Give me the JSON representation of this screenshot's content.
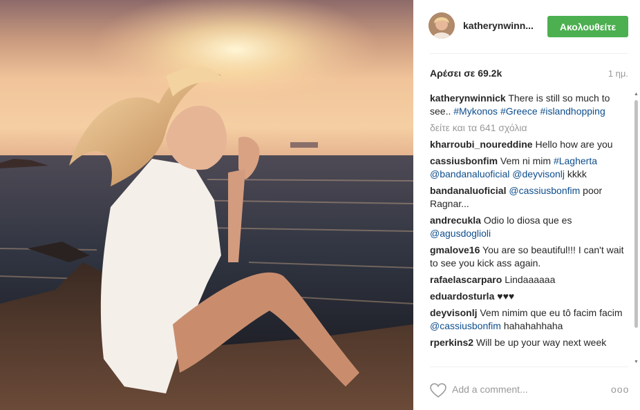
{
  "post": {
    "photo_icon": "photo",
    "username": "katherynwinn...",
    "follow_label": "Ακολουθείτε",
    "likes_text": "Αρέσει σε 69.2k",
    "time_text": "1 ημ.",
    "view_all_text": "δείτε και τα 641 σχόλια",
    "add_comment_placeholder": "Add a comment...",
    "more_label": "ooo",
    "colors": {
      "follow_button": "#4caf50",
      "hashtag": "#0d4d8c",
      "muted": "#999999"
    }
  },
  "caption": {
    "user": "katherynwinnick",
    "text": "There is still so much to see..",
    "tags": [
      "#Mykonos",
      "#Greece",
      "#islandhopping"
    ]
  },
  "comments": [
    {
      "user": "kharroubi_noureddine",
      "text": "Hello how are you"
    },
    {
      "user": "cassiusbonfim",
      "text": "Vem ni mim",
      "tags": [
        "#Lagherta",
        "@bandanaluoficial",
        "@deyvisonlj"
      ],
      "text2": "kkkk"
    },
    {
      "user": "bandanaluoficial",
      "tag": "@cassiusbonfim",
      "text": "poor Ragnar..."
    },
    {
      "user": "andrecukla",
      "text": "Odio lo diosa que es",
      "tag": "@agusdoglioli"
    },
    {
      "user": "gmalove16",
      "text": "You are so beautiful!!! I can't wait to see you kick ass again."
    },
    {
      "user": "rafaelascarparo",
      "text": "Lindaaaaaa"
    },
    {
      "user": "eduardosturla",
      "text": "♥♥♥"
    },
    {
      "user": "deyvisonlj",
      "text": "Vem nimim que eu tô facim facim",
      "tag": "@cassiusbonfim",
      "text2": "hahahahhaha"
    },
    {
      "user": "rperkins2",
      "text": "Will be up your way next week"
    }
  ]
}
